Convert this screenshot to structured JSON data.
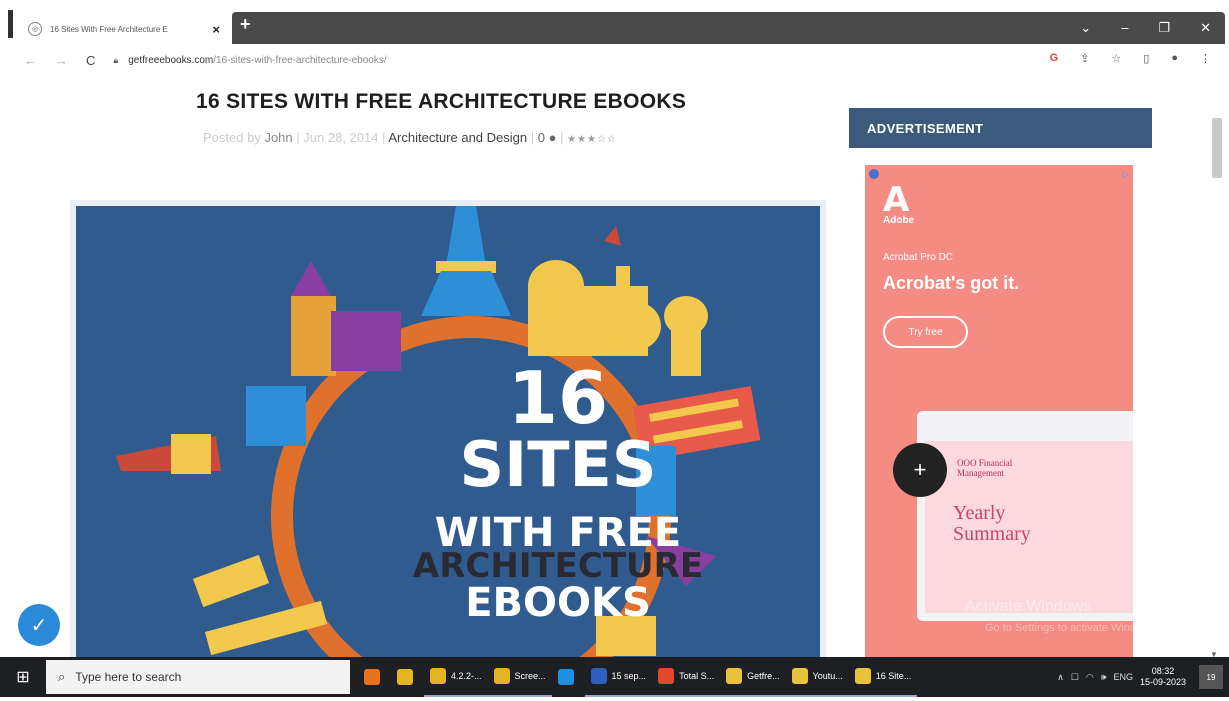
{
  "browser": {
    "tab_title": "16 Sites With Free Architecture E",
    "tab_close": "×",
    "new_tab": "+",
    "window_controls": [
      "⌄",
      "–",
      "❐",
      "✕"
    ],
    "url_host": "getfreeebooks.com",
    "url_path": "/16-sites-with-free-architecture-ebooks/",
    "toolbar_icons": [
      "google-icon",
      "share-icon",
      "star-icon",
      "sidepanel-icon",
      "profile-icon",
      "menu-icon"
    ]
  },
  "article": {
    "title": "16 SITES WITH FREE ARCHITECTURE EBOOKS",
    "posted_by": "Posted by",
    "author": "John",
    "date": "Jun 28, 2014",
    "category": "Architecture and Design",
    "comments": "0",
    "hero": {
      "line1": "16",
      "line2": "SITES",
      "line3": "WITH FREE",
      "line4": "ARCHITECTURE",
      "line5": "EBOOKS"
    }
  },
  "sidebar": {
    "ad_header": "ADVERTISEMENT",
    "ad": {
      "brand": "Adobe",
      "product": "Acrobat Pro DC",
      "headline": "Acrobat's got it.",
      "cta": "Try free",
      "doc_title_1": "OOO Financial",
      "doc_title_2": "Management",
      "doc_big_1": "Yearly",
      "doc_big_2": "Summary"
    },
    "watermark_1": "Activate Windows",
    "watermark_2": "Go to Settings to activate Windows."
  },
  "taskbar": {
    "search_placeholder": "Type here to search",
    "apps": [
      {
        "label": "",
        "color": "#e8721c",
        "name": "firefox-app"
      },
      {
        "label": "",
        "color": "#e6b422",
        "name": "notes-app"
      },
      {
        "label": "4.2.2-...",
        "color": "#e6b422",
        "name": "folder-app-1"
      },
      {
        "label": "Scree...",
        "color": "#e6b422",
        "name": "folder-app-2"
      },
      {
        "label": "",
        "color": "#1f8fe0",
        "name": "edge-app"
      },
      {
        "label": "15 sep...",
        "color": "#2b5fc0",
        "name": "word-app"
      },
      {
        "label": "Total S...",
        "color": "#e04a2a",
        "name": "total-app"
      },
      {
        "label": "Getfre...",
        "color": "#e8c23a",
        "name": "chrome-app-1"
      },
      {
        "label": "Youtu...",
        "color": "#e8c23a",
        "name": "chrome-app-2"
      },
      {
        "label": "16 Site...",
        "color": "#e8c23a",
        "name": "chrome-app-3"
      }
    ],
    "lang": "ENG",
    "time": "08:32",
    "date": "15-09-2023",
    "notif_count": "19"
  }
}
